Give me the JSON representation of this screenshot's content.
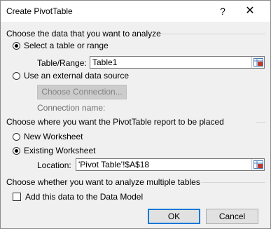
{
  "dialog": {
    "title": "Create PivotTable",
    "help_label": "?",
    "close_label": "✕"
  },
  "source": {
    "heading": "Choose the data that you want to analyze",
    "select_table_label": "Select a table or range",
    "table_range_label": "Table/Range:",
    "table_range_value": "Table1",
    "external_label": "Use an external data source",
    "choose_connection_label": "Choose Connection...",
    "connection_name_label": "Connection name:"
  },
  "placement": {
    "heading": "Choose where you want the PivotTable report to be placed",
    "new_worksheet_label": "New Worksheet",
    "existing_worksheet_label": "Existing Worksheet",
    "location_label": "Location:",
    "location_value": "'Pivot Table'!$A$18"
  },
  "multiple": {
    "heading": "Choose whether you want to analyze multiple tables",
    "data_model_label": "Add this data to the Data Model"
  },
  "buttons": {
    "ok_label": "OK",
    "cancel_label": "Cancel"
  },
  "state": {
    "source_selected": "Select a table or range",
    "placement_selected": "Existing Worksheet",
    "data_model_checked": false
  },
  "colors": {
    "accent": "#0078d7",
    "dialog_bg": "#f0f0f0"
  }
}
